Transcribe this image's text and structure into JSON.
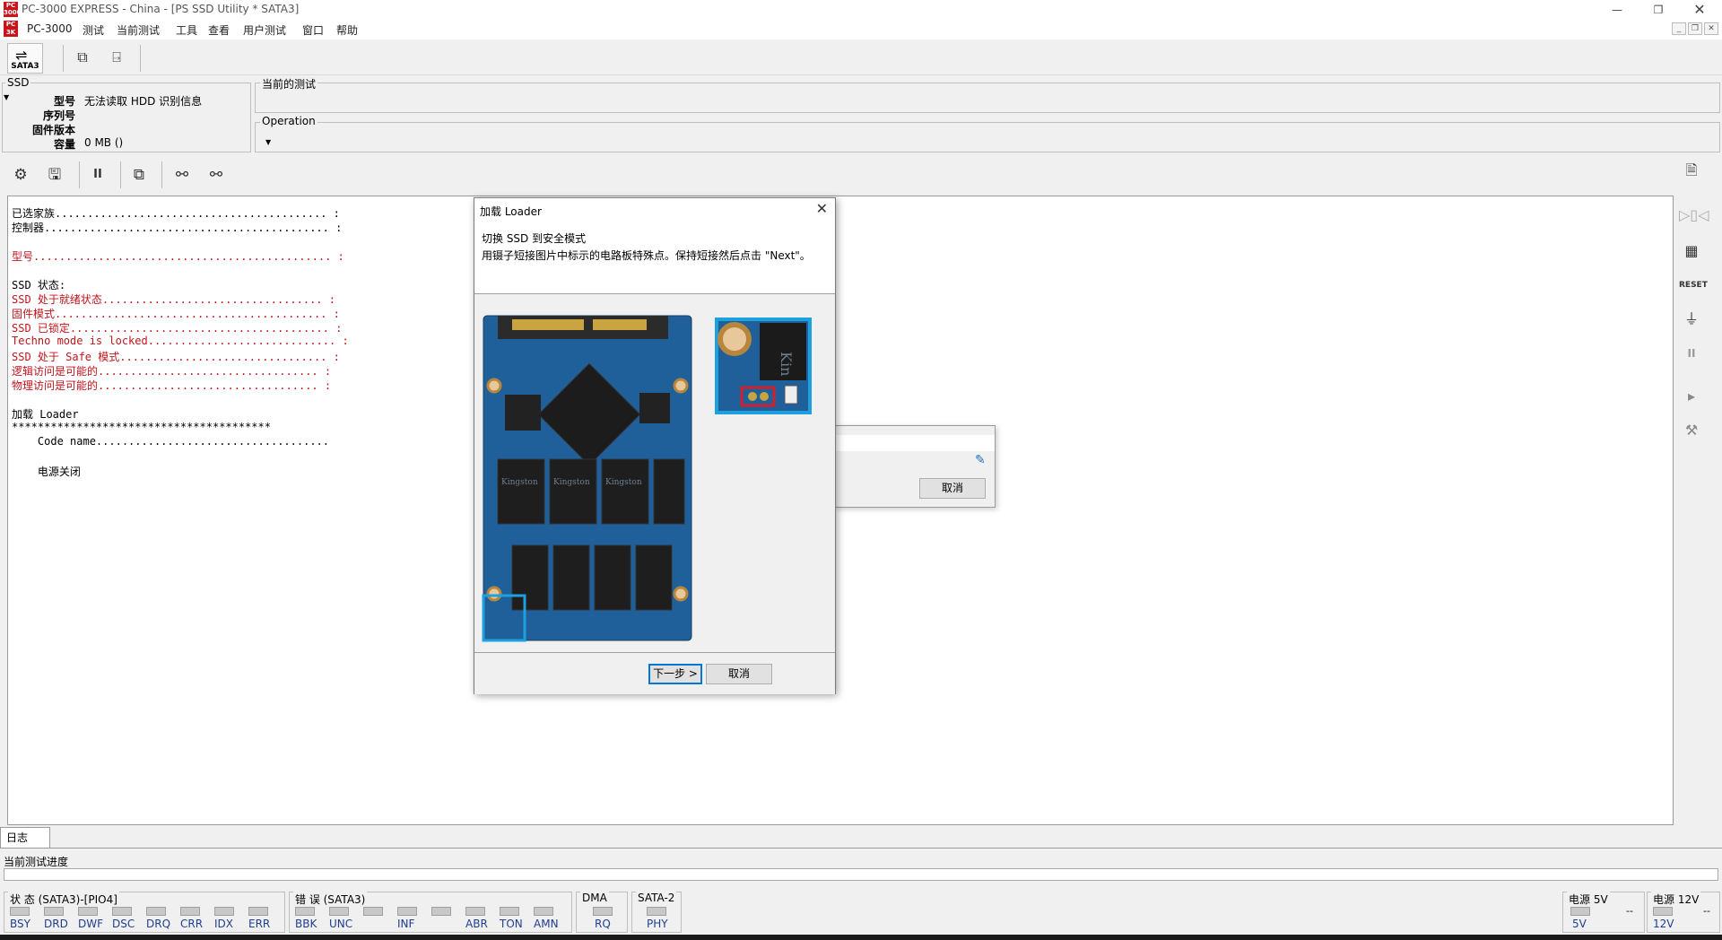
{
  "window": {
    "title": "PC-3000 EXPRESS - China - [PS SSD Utility * SATA3]",
    "logo_text": "PC 3000"
  },
  "menu": {
    "items": [
      "PC-3000",
      "测试",
      "当前测试",
      "工具",
      "查看",
      "用户测试",
      "窗口",
      "帮助"
    ]
  },
  "toolbar": {
    "sata_label": "SATA3"
  },
  "ssd_info": {
    "group_label": "SSD",
    "model_key": "型号",
    "model_value": "无法读取 HDD 识别信息",
    "serial_key": "序列号",
    "firmware_key": "固件版本",
    "capacity_key": "容量",
    "capacity_value": "0 MB ()"
  },
  "current_test": {
    "label": "当前的测试"
  },
  "operation": {
    "label": "Operation"
  },
  "log": {
    "lines": [
      {
        "text": "已选家族.......................................... :",
        "color": "black"
      },
      {
        "text": "控制器............................................ :",
        "color": "black"
      },
      {
        "text": "",
        "color": "black"
      },
      {
        "text": "型号.............................................. :",
        "color": "red"
      },
      {
        "text": "",
        "color": "black"
      },
      {
        "text": "SSD 状态:",
        "color": "black"
      },
      {
        "text": "SSD 处于就绪状态.................................. :",
        "color": "red"
      },
      {
        "text": "固件模式.......................................... :",
        "color": "red"
      },
      {
        "text": "SSD 已锁定........................................ :",
        "color": "red"
      },
      {
        "text": "Techno mode is locked............................. :",
        "color": "red"
      },
      {
        "text": "SSD 处于 Safe 模式................................ :",
        "color": "red"
      },
      {
        "text": "逻辑访问是可能的.................................. :",
        "color": "red"
      },
      {
        "text": "物理访问是可能的.................................. :",
        "color": "red"
      },
      {
        "text": "",
        "color": "black"
      },
      {
        "text": "加载 Loader",
        "color": "black"
      },
      {
        "text": "****************************************",
        "color": "black"
      },
      {
        "text": "    Code name....................................",
        "color": "black"
      },
      {
        "text": "",
        "color": "black"
      },
      {
        "text": "    电源关闭",
        "color": "black"
      }
    ]
  },
  "bottom": {
    "log_tab": "日志",
    "progress_label": "当前测试进度",
    "status_title": "状 态 (SATA3)-[PIO4]",
    "status_leds": [
      "BSY",
      "DRD",
      "DWF",
      "DSC",
      "DRQ",
      "CRR",
      "IDX",
      "ERR"
    ],
    "error_title": "错 误 (SATA3)",
    "error_leds": [
      "BBK",
      "UNC",
      "",
      "INF",
      "",
      "ABR",
      "TON",
      "AMN"
    ],
    "dma_title": "DMA",
    "dma_leds": [
      "RQ"
    ],
    "sata2_title": "SATA-2",
    "sata2_leds": [
      "PHY"
    ],
    "power5_title": "电源 5V",
    "power5_led": "5V",
    "power5_value": "--",
    "power12_title": "电源 12V",
    "power12_led": "12V",
    "power12_value": "--"
  },
  "dialog": {
    "title": "加载 Loader",
    "heading": "切换 SSD 到安全模式",
    "instruction": "用镊子短接图片中标示的电路板特殊点。保持短接然后点击 \"Next\"。",
    "next_button": "下一步 >",
    "cancel_button": "取消",
    "pcb_chip_brand": "Kingston",
    "zoom_brand": "Kin"
  },
  "popup": {
    "cancel_button": "取消"
  },
  "colors": {
    "accent_red": "#c0141b",
    "dialog_highlight": "#1ca0e0",
    "pcb_blue": "#1f5f9a"
  }
}
